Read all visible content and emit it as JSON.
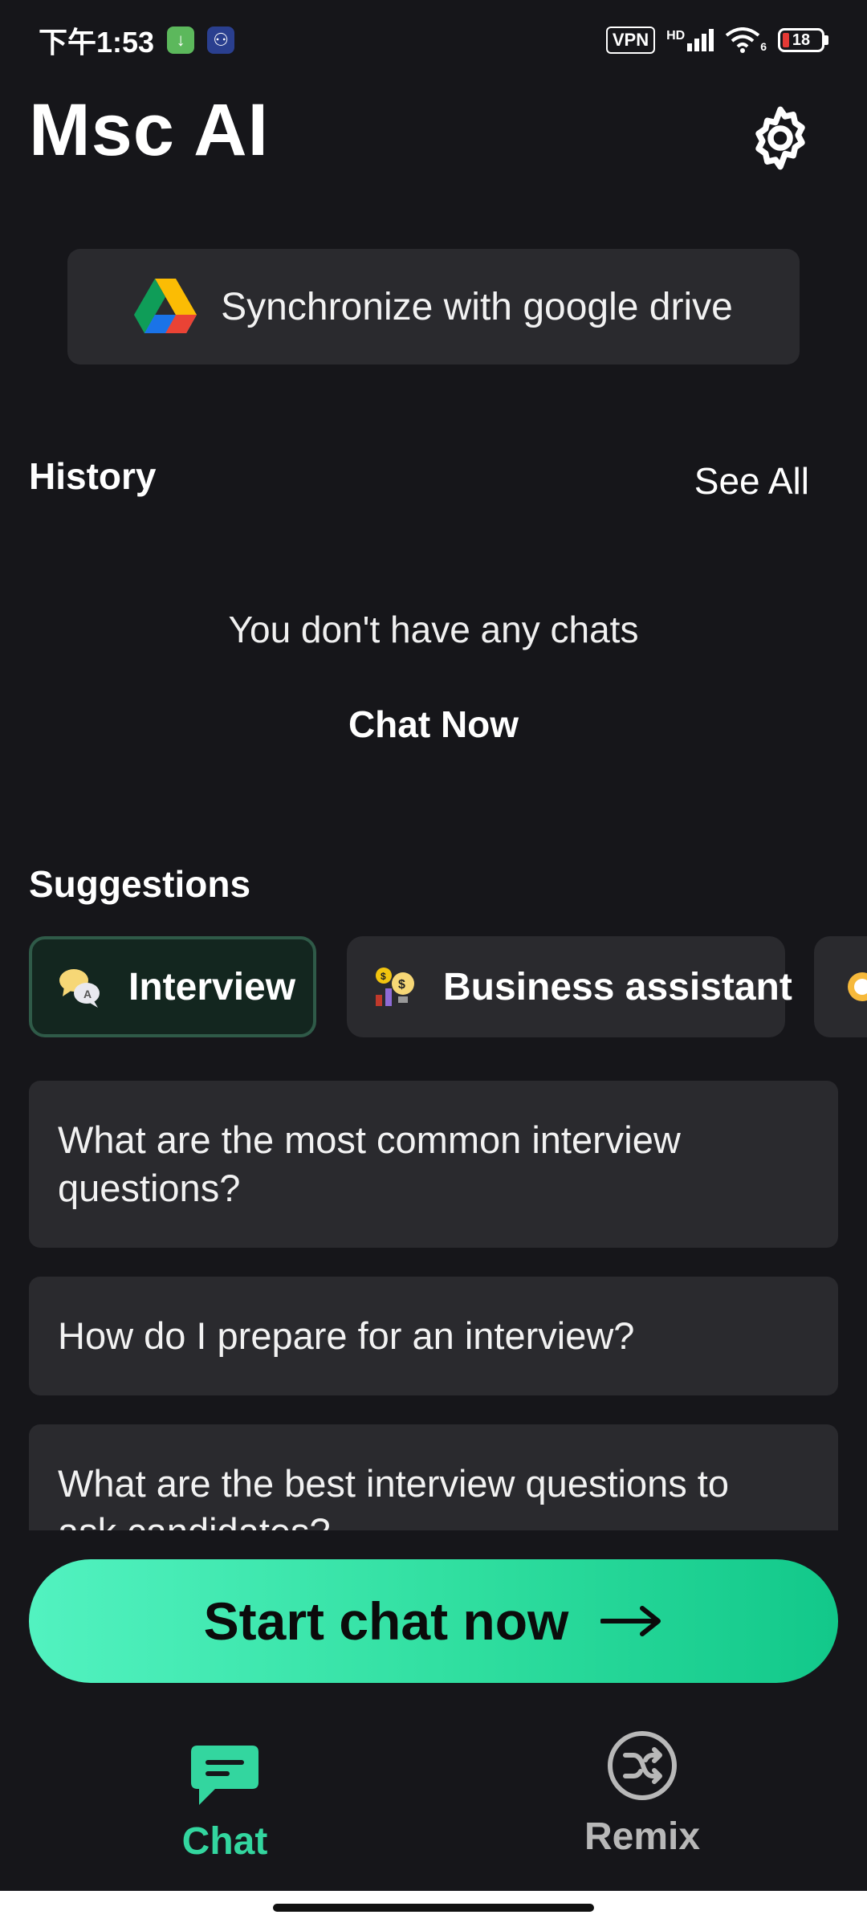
{
  "status_bar": {
    "time": "下午1:53",
    "vpn_label": "VPN",
    "signal_label": "HD",
    "wifi_label": "6",
    "battery": "18"
  },
  "header": {
    "title": "Msc AI"
  },
  "sync": {
    "label": "Synchronize with google drive"
  },
  "history": {
    "title": "History",
    "see_all": "See All",
    "empty_text": "You don't have any chats",
    "chat_now": "Chat Now"
  },
  "suggestions": {
    "title": "Suggestions",
    "chips": [
      {
        "label": "Interview",
        "active": true
      },
      {
        "label": "Business assistant",
        "active": false
      },
      {
        "label": "",
        "active": false
      }
    ],
    "questions": [
      "What are the most common interview questions?",
      "How do I prepare for an interview?",
      "What are the best interview questions to ask candidates?"
    ]
  },
  "cta": {
    "label": "Start chat now"
  },
  "nav": {
    "tabs": [
      {
        "label": "Chat",
        "active": true
      },
      {
        "label": "Remix",
        "active": false
      }
    ]
  },
  "colors": {
    "background": "#16161a",
    "card": "#2a2a2e",
    "accent": "#33d69f",
    "inactive": "#b8b8b8"
  }
}
